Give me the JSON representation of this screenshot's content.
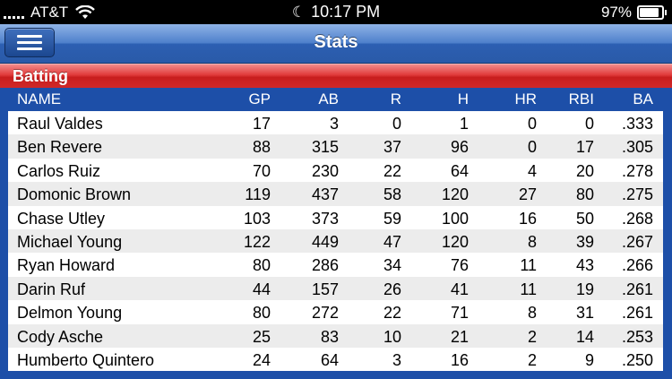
{
  "status_bar": {
    "carrier": "AT&T",
    "time": "10:17 PM",
    "battery": "97%",
    "battery_level": 0.97,
    "icons": [
      "signal-icon",
      "wifi-icon",
      "moon-icon",
      "battery-icon"
    ]
  },
  "nav": {
    "title": "Stats",
    "menu_icon": "hamburger-menu-icon"
  },
  "section": {
    "title": "Batting"
  },
  "table": {
    "columns": [
      "NAME",
      "GP",
      "AB",
      "R",
      "H",
      "HR",
      "RBI",
      "BA"
    ],
    "rows": [
      [
        "Raul Valdes",
        "17",
        "3",
        "0",
        "1",
        "0",
        "0",
        ".333"
      ],
      [
        "Ben Revere",
        "88",
        "315",
        "37",
        "96",
        "0",
        "17",
        ".305"
      ],
      [
        "Carlos Ruiz",
        "70",
        "230",
        "22",
        "64",
        "4",
        "20",
        ".278"
      ],
      [
        "Domonic Brown",
        "119",
        "437",
        "58",
        "120",
        "27",
        "80",
        ".275"
      ],
      [
        "Chase Utley",
        "103",
        "373",
        "59",
        "100",
        "16",
        "50",
        ".268"
      ],
      [
        "Michael Young",
        "122",
        "449",
        "47",
        "120",
        "8",
        "39",
        ".267"
      ],
      [
        "Ryan Howard",
        "80",
        "286",
        "34",
        "76",
        "11",
        "43",
        ".266"
      ],
      [
        "Darin Ruf",
        "44",
        "157",
        "26",
        "41",
        "11",
        "19",
        ".261"
      ],
      [
        "Delmon Young",
        "80",
        "272",
        "22",
        "71",
        "8",
        "31",
        ".261"
      ],
      [
        "Cody Asche",
        "25",
        "83",
        "10",
        "21",
        "2",
        "14",
        ".253"
      ],
      [
        "Humberto Quintero",
        "24",
        "64",
        "3",
        "16",
        "2",
        "9",
        ".250"
      ]
    ]
  },
  "colors": {
    "nav_blue": "#2c5fb2",
    "table_header_blue": "#1d4fa8",
    "section_red": "#d02828",
    "row_alt": "#ececec"
  }
}
